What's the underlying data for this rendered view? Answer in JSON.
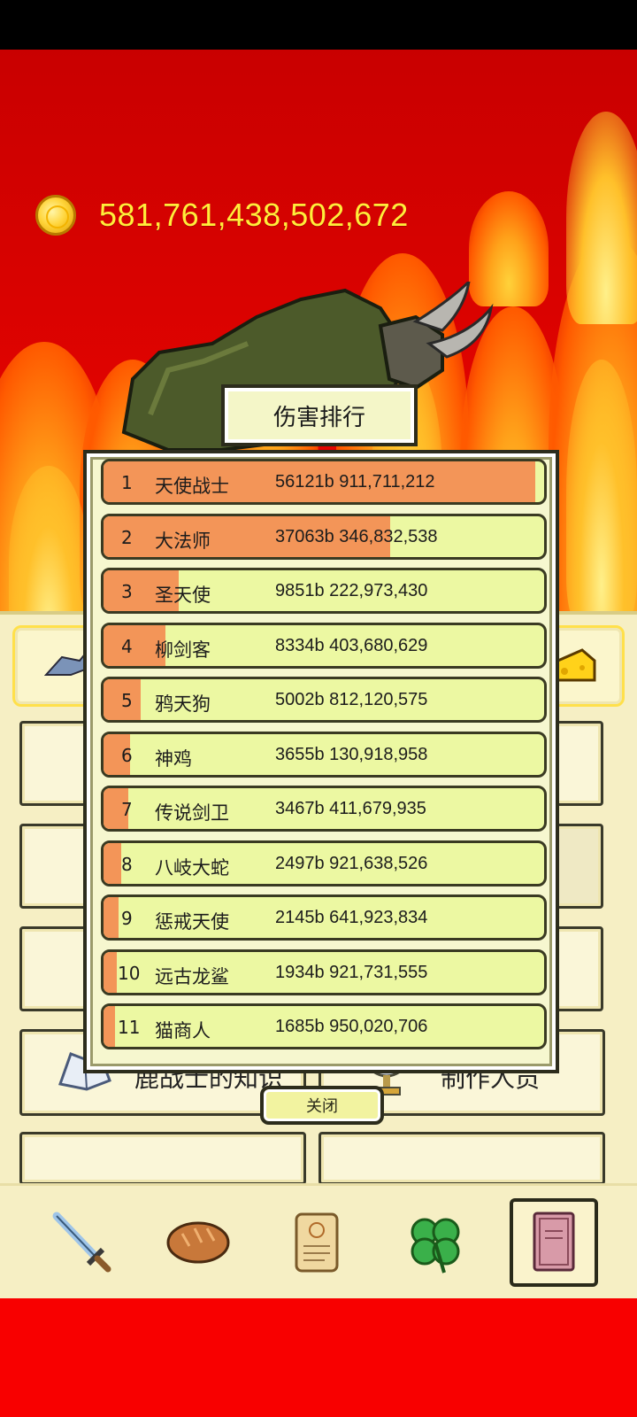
{
  "coins": {
    "amount": "581,761,438,502,672"
  },
  "ranking": {
    "title": "伤害排行",
    "close_label": "关闭",
    "rows": [
      {
        "rank": "1",
        "name": "天使战士",
        "damage": "56121b 911,711,212",
        "share": 0.98
      },
      {
        "rank": "2",
        "name": "大法师",
        "damage": "37063b 346,832,538",
        "share": 0.65
      },
      {
        "rank": "3",
        "name": "圣天使",
        "damage": "9851b 222,973,430",
        "share": 0.17
      },
      {
        "rank": "4",
        "name": "柳剑客",
        "damage": "8334b 403,680,629",
        "share": 0.14
      },
      {
        "rank": "5",
        "name": "鸦天狗",
        "damage": "5002b 812,120,575",
        "share": 0.085
      },
      {
        "rank": "6",
        "name": "神鸡",
        "damage": "3655b 130,918,958",
        "share": 0.06
      },
      {
        "rank": "7",
        "name": "传说剑卫",
        "damage": "3467b 411,679,935",
        "share": 0.057
      },
      {
        "rank": "8",
        "name": "八岐大蛇",
        "damage": "2497b 921,638,526",
        "share": 0.04
      },
      {
        "rank": "9",
        "name": "惩戒天使",
        "damage": "2145b 641,923,834",
        "share": 0.035
      },
      {
        "rank": "10",
        "name": "远古龙鲨",
        "damage": "1934b 921,731,555",
        "share": 0.031
      },
      {
        "rank": "11",
        "name": "猫商人",
        "damage": "1685b 950,020,706",
        "share": 0.027
      }
    ]
  },
  "menu": {
    "knowledge_label": "鹿战士的知识",
    "credits_label": "制作人员"
  },
  "nav": {
    "items": [
      "sword-icon",
      "bread-icon",
      "scroll-icon",
      "clover-icon",
      "book-icon"
    ],
    "active": "book-icon"
  }
}
